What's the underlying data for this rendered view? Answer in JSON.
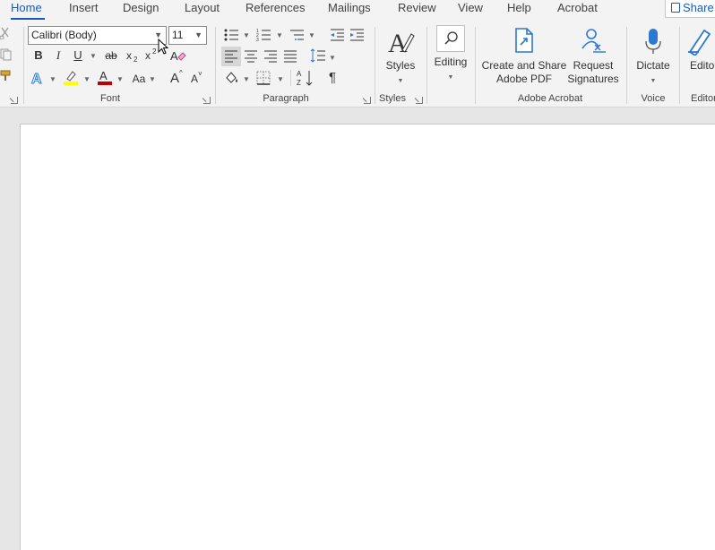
{
  "tabs": [
    "Home",
    "Insert",
    "Design",
    "Layout",
    "References",
    "Mailings",
    "Review",
    "View",
    "Help",
    "Acrobat"
  ],
  "share_label": "Share",
  "font": {
    "name": "Calibri (Body)",
    "size": "11",
    "group_label": "Font",
    "bold": "B",
    "italic": "I",
    "underline": "U",
    "strike": "ab",
    "change_case": "Aa"
  },
  "paragraph": {
    "group_label": "Paragraph"
  },
  "styles": {
    "label": "Styles",
    "group_label": "Styles"
  },
  "editing": {
    "label": "Editing"
  },
  "acrobat": {
    "create_share": [
      "Create and Share",
      "Adobe PDF"
    ],
    "request_sig": [
      "Request",
      "Signatures"
    ],
    "group_label": "Adobe Acrobat"
  },
  "voice": {
    "dictate": "Dictate",
    "group_label": "Voice"
  },
  "editor": {
    "label": "Editor",
    "group_label": "Editor"
  },
  "colors": {
    "accent": "#185abd",
    "highlight": "#ffff00",
    "font_color": "#c00000",
    "acrobat_blue": "#2b79d0"
  }
}
